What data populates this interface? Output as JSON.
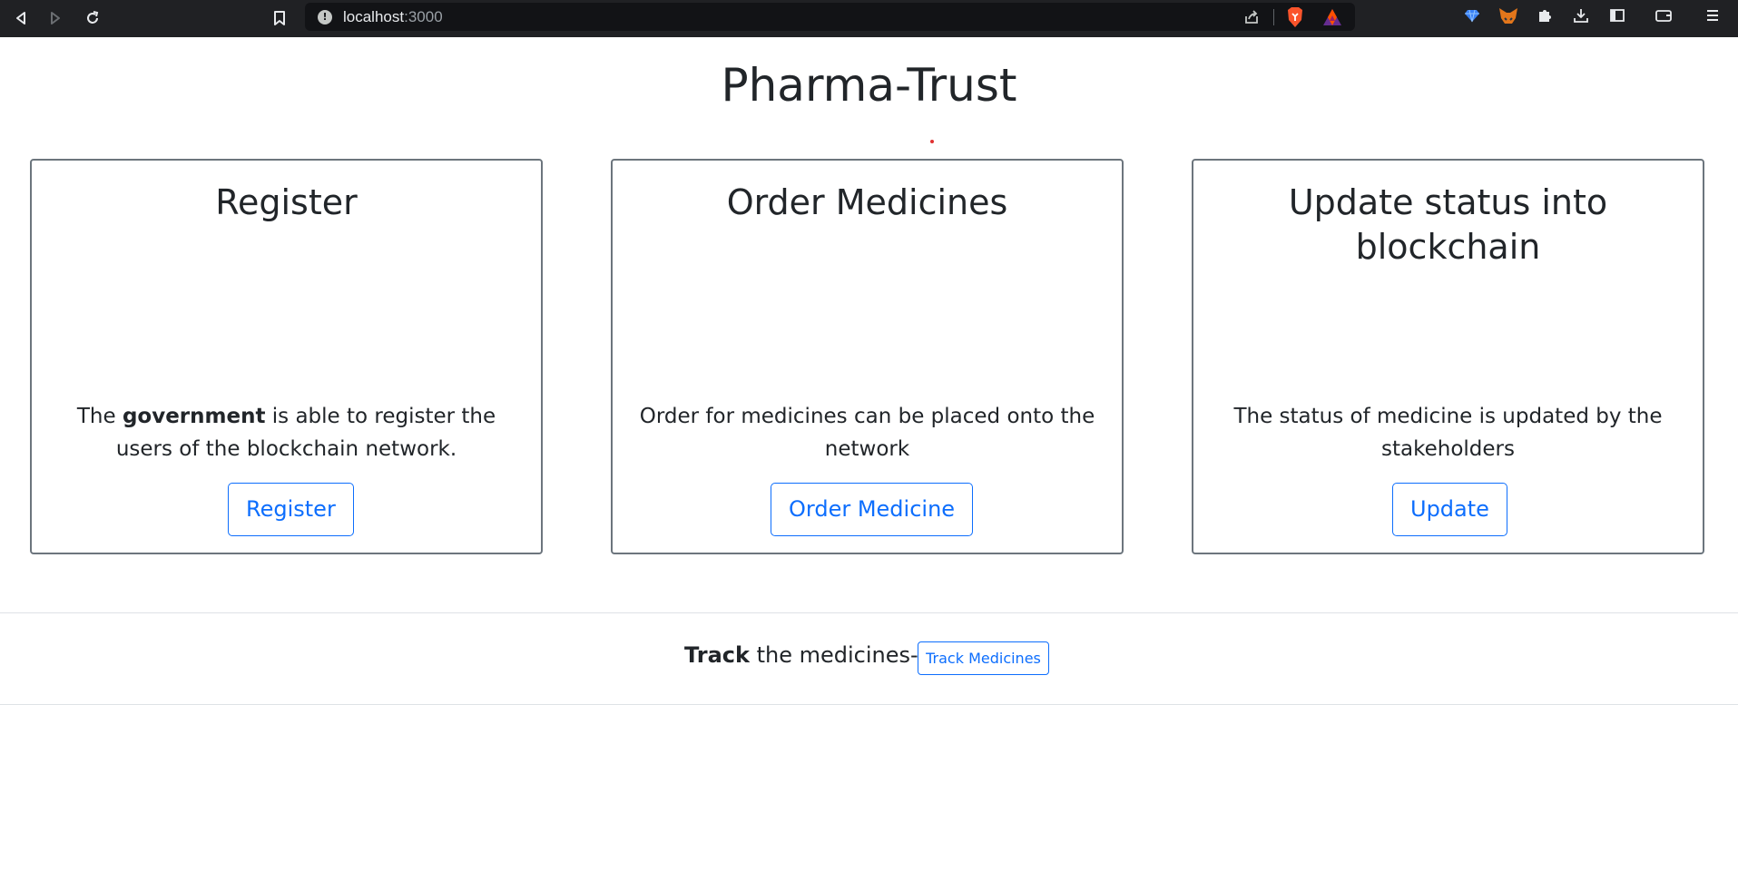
{
  "browser": {
    "url_host": "localhost",
    "url_port": ":3000",
    "icons": [
      "back-icon",
      "forward-icon",
      "reload-icon",
      "bookmark-icon",
      "site-info-icon",
      "share-icon",
      "brave-shields-icon",
      "brave-rewards-icon",
      "extension-gem-icon",
      "metamask-icon",
      "extensions-puzzle-icon",
      "downloads-icon",
      "sidebar-icon",
      "wallet-icon",
      "menu-icon"
    ]
  },
  "page": {
    "title": "Pharma-Trust"
  },
  "cards": [
    {
      "title": "Register",
      "text_bold": "government",
      "text_before": "The ",
      "text_after": " is able to register the users of the blockchain network.",
      "button": "Register"
    },
    {
      "title": "Order Medicines",
      "text": "Order for medicines can be placed onto the network",
      "button": "Order Medicine"
    },
    {
      "title": "Update status into blockchain",
      "text": "The status of medicine is updated by the stakeholders",
      "button": "Update"
    }
  ],
  "track": {
    "label_bold": "Track",
    "label_rest": " the medicines-",
    "button": "Track Medicines"
  },
  "colors": {
    "accent": "#0d6efd",
    "text": "#212529",
    "card_border": "#6c757d",
    "browser_bar": "#202124"
  }
}
